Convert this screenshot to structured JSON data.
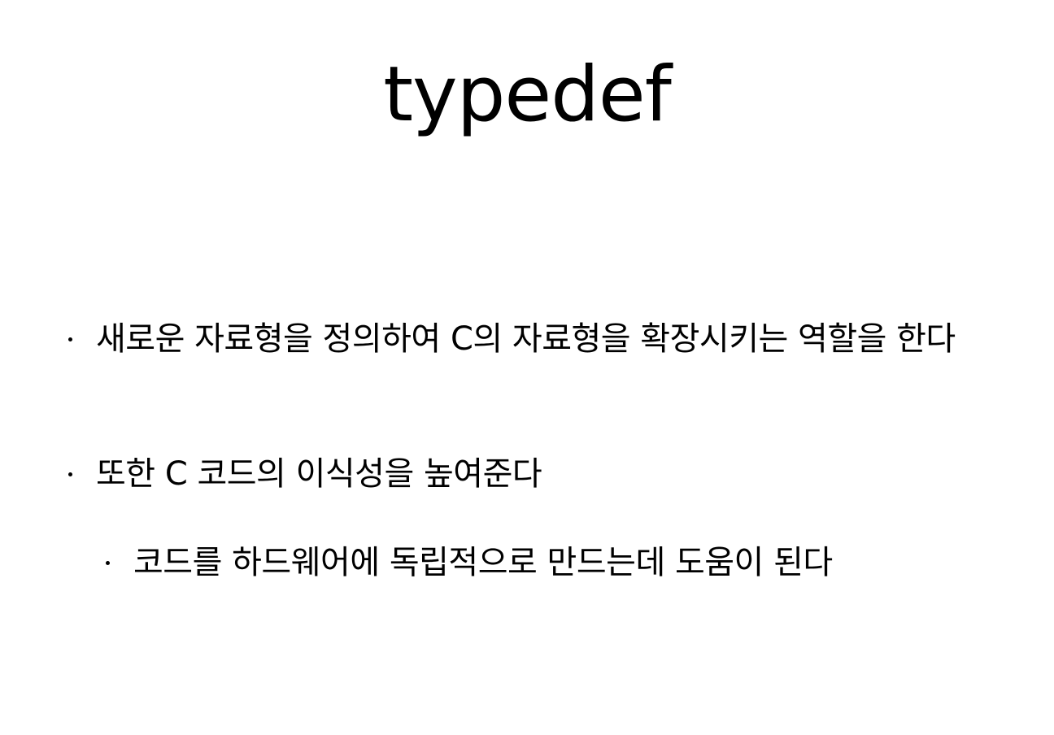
{
  "slide": {
    "title": "typedef",
    "bullets": [
      {
        "text": "새로운 자료형을 정의하여 C의 자료형을 확장시키는 역할을 한다",
        "level": 1
      },
      {
        "text": "또한 C 코드의 이식성을 높여준다",
        "level": 1
      },
      {
        "text": "코드를 하드웨어에 독립적으로 만드는데 도움이 된다",
        "level": 2
      }
    ]
  }
}
